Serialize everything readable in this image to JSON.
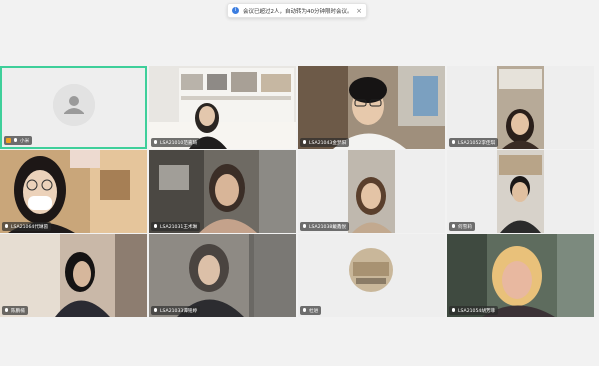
{
  "notice": {
    "text": "会议已超过2人，自动转为40分钟限时会议。",
    "info_icon": "info-icon",
    "close_icon": "close-icon"
  },
  "participants": [
    {
      "name": "小米",
      "host": true
    },
    {
      "name": "LSA21010范嘉琦"
    },
    {
      "name": "LSA21043金梦阳"
    },
    {
      "name": "LSA21052李佳琪"
    },
    {
      "name": "LSA21064代琳茵"
    },
    {
      "name": "LSA21031王术琳"
    },
    {
      "name": "LSA21038戴鑫悦"
    },
    {
      "name": "何雪莉"
    },
    {
      "name": "陈鹏楠"
    },
    {
      "name": "LSA21033谭铭婷"
    },
    {
      "name": "杜进"
    },
    {
      "name": "LSA21054胡芳菲"
    }
  ],
  "colors": {
    "background": "#f2f2f2",
    "active_border": "#3ecf9a",
    "info_blue": "#3b7de0",
    "host_badge": "#f0a020"
  }
}
